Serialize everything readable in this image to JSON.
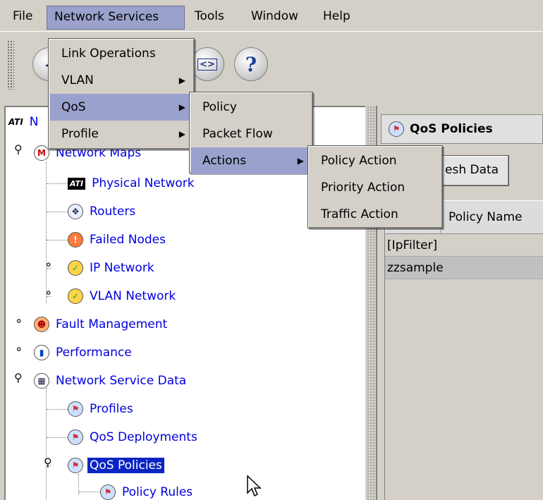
{
  "menubar": {
    "items": [
      {
        "label": "File"
      },
      {
        "label": "Network Services"
      },
      {
        "label": "Tools"
      },
      {
        "label": "Window"
      },
      {
        "label": "Help"
      }
    ]
  },
  "menus": {
    "network_services": {
      "items": [
        "Link Operations",
        "VLAN",
        "QoS",
        "Profile"
      ]
    },
    "qos": {
      "items": [
        "Policy",
        "Packet Flow",
        "Actions"
      ]
    },
    "actions": {
      "items": [
        "Policy Action",
        "Priority Action",
        "Traffic Action"
      ]
    }
  },
  "toolbar": {
    "help_glyph": "?",
    "nav_glyph": "<>"
  },
  "tree": {
    "root_label": "N",
    "network_maps": "Network Maps",
    "physical_network": "Physical Network",
    "routers": "Routers",
    "failed_nodes": "Failed Nodes",
    "ip_network": "IP Network",
    "vlan_network": "VLAN Network",
    "fault_management": "Fault Management",
    "performance": "Performance",
    "network_service_data": "Network Service Data",
    "profiles": "Profiles",
    "qos_deployments": "QoS Deployments",
    "qos_policies": "QoS Policies",
    "policy_rules": "Policy Rules"
  },
  "right_panel": {
    "tab_title": "QoS Policies",
    "refresh_label": "esh Data",
    "column_header": "Policy Name",
    "rows": [
      "[IpFilter]",
      "zzsample"
    ]
  },
  "colors": {
    "menu_highlight": "#9aa1cc",
    "tree_link": "#0000e0",
    "selection": "#0a24c4"
  }
}
